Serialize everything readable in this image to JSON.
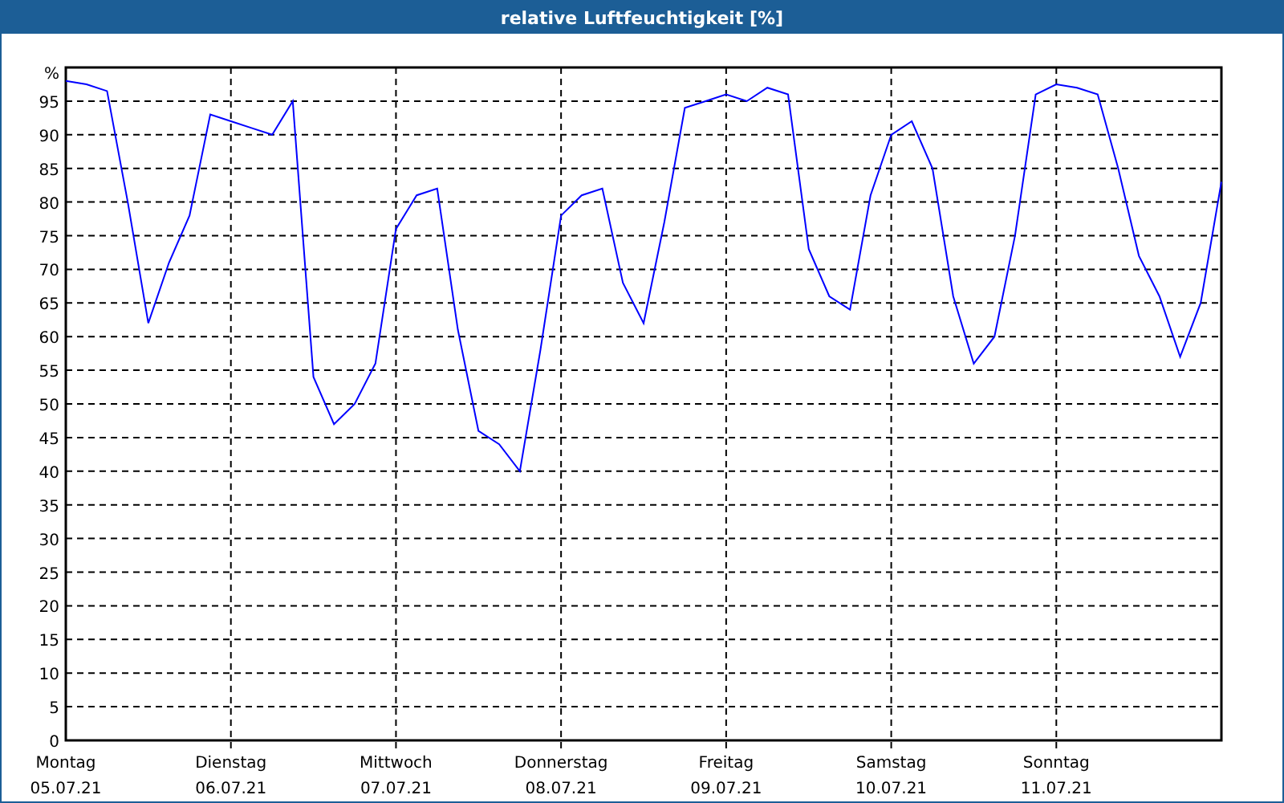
{
  "window": {
    "title": "relative Luftfeuchtigkeit [%]"
  },
  "chart": {
    "chart_data": {
      "type": "line",
      "grid": true,
      "ylabel": "%",
      "ylim": [
        0,
        100
      ],
      "yticks": [
        0,
        5,
        10,
        15,
        20,
        25,
        30,
        35,
        40,
        45,
        50,
        55,
        60,
        65,
        70,
        75,
        80,
        85,
        90,
        95
      ],
      "categories": [
        "Montag",
        null,
        null,
        null,
        null,
        null,
        null,
        null,
        "Dienstag",
        null,
        null,
        null,
        null,
        null,
        null,
        null,
        "Mittwoch",
        null,
        null,
        null,
        null,
        null,
        null,
        null,
        "Donnerstag",
        null,
        null,
        null,
        null,
        null,
        null,
        null,
        "Freitag",
        null,
        null,
        null,
        null,
        null,
        null,
        null,
        "Samstag",
        null,
        null,
        null,
        null,
        null,
        null,
        null,
        "Sonntag",
        null,
        null,
        null,
        null,
        null,
        null,
        null,
        null
      ],
      "series": [
        {
          "color": "#0000ff",
          "values": [
            98,
            97.5,
            96.5,
            80,
            62,
            71,
            78,
            93,
            92,
            91,
            90,
            95,
            54,
            47,
            50,
            56,
            76,
            81,
            82,
            61,
            46,
            44,
            40,
            58,
            78,
            81,
            82,
            68,
            62,
            77,
            94,
            95,
            96,
            95,
            97,
            96,
            73,
            66,
            64,
            81,
            90,
            92,
            85,
            66,
            56,
            60,
            75,
            96,
            97.5,
            97,
            96,
            85,
            72,
            66,
            57,
            65,
            83
          ]
        }
      ]
    },
    "x_axis_dates": [
      "05.07.21",
      "06.07.21",
      "07.07.21",
      "08.07.21",
      "09.07.21",
      "10.07.21",
      "11.07.21"
    ]
  }
}
